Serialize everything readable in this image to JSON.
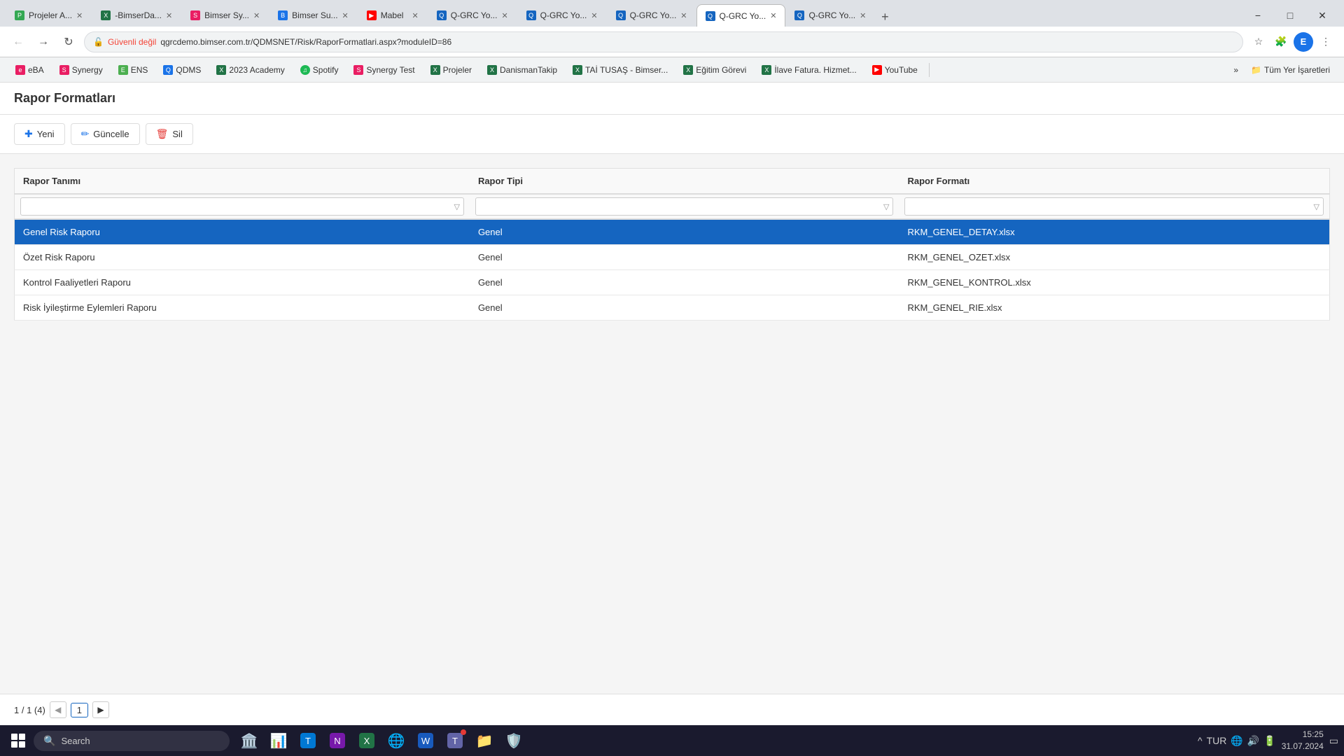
{
  "browser": {
    "tabs": [
      {
        "id": "tab1",
        "label": "Projeler A...",
        "favicon_color": "#34a853",
        "favicon_letter": "P",
        "active": false
      },
      {
        "id": "tab2",
        "label": "-BimserDa...",
        "favicon_color": "#217346",
        "favicon_letter": "X",
        "active": false
      },
      {
        "id": "tab3",
        "label": "Bimser Sy...",
        "favicon_color": "#e91e63",
        "favicon_letter": "S",
        "active": false
      },
      {
        "id": "tab4",
        "label": "Bimser Su...",
        "favicon_color": "#1a73e8",
        "favicon_letter": "B",
        "active": false
      },
      {
        "id": "tab5",
        "label": "Mabel",
        "favicon_color": "#ff0000",
        "favicon_letter": "▶",
        "active": false
      },
      {
        "id": "tab6",
        "label": "Q-GRC Yo...",
        "favicon_color": "#1565c0",
        "favicon_letter": "Q",
        "active": false
      },
      {
        "id": "tab7",
        "label": "Q-GRC Yo...",
        "favicon_color": "#1565c0",
        "favicon_letter": "Q",
        "active": false
      },
      {
        "id": "tab8",
        "label": "Q-GRC Yo...",
        "favicon_color": "#1565c0",
        "favicon_letter": "Q",
        "active": false
      },
      {
        "id": "tab9",
        "label": "Q-GRC Yo...",
        "favicon_color": "#1565c0",
        "favicon_letter": "Q",
        "active": true
      },
      {
        "id": "tab10",
        "label": "Q-GRC Yo...",
        "favicon_color": "#1565c0",
        "favicon_letter": "Q",
        "active": false
      }
    ],
    "address": "qgrcdemo.bimser.com.tr/QDMSNET/Risk/RaporFormatlari.aspx?moduleID=86",
    "security_label": "Güvenli değil",
    "profile_letter": "E"
  },
  "bookmarks": [
    {
      "label": "eBA",
      "color": "#e91e63"
    },
    {
      "label": "Synergy",
      "color": "#e91e63"
    },
    {
      "label": "ENS",
      "color": "#4caf50"
    },
    {
      "label": "QDMS",
      "color": "#1a73e8"
    },
    {
      "label": "2023 Academy",
      "color": "#217346"
    },
    {
      "label": "Spotify",
      "color": "#1db954"
    },
    {
      "label": "Synergy Test",
      "color": "#e91e63"
    },
    {
      "label": "Projeler",
      "color": "#217346"
    },
    {
      "label": "DanismanTakip",
      "color": "#217346"
    },
    {
      "label": "TAİ TUSAŞ - Bimser...",
      "color": "#217346"
    },
    {
      "label": "Eğitim Görevi",
      "color": "#217346"
    },
    {
      "label": "İlave Fatura. Hizmet...",
      "color": "#217346"
    },
    {
      "label": "YouTube",
      "color": "#ff0000"
    },
    {
      "label": "Tüm Yer İşaretleri",
      "is_folder": true
    }
  ],
  "page": {
    "title": "Rapor Formatları",
    "toolbar": {
      "new_label": "Yeni",
      "update_label": "Güncelle",
      "delete_label": "Sil"
    },
    "table": {
      "columns": [
        {
          "key": "rapor_tanimi",
          "label": "Rapor Tanımı"
        },
        {
          "key": "rapor_tipi",
          "label": "Rapor Tipi"
        },
        {
          "key": "rapor_formati",
          "label": "Rapor Formatı"
        }
      ],
      "rows": [
        {
          "rapor_tanimi": "Genel Risk Raporu",
          "rapor_tipi": "Genel",
          "rapor_formati": "RKM_GENEL_DETAY.xlsx",
          "selected": true
        },
        {
          "rapor_tanimi": "Özet Risk Raporu",
          "rapor_tipi": "Genel",
          "rapor_formati": "RKM_GENEL_OZET.xlsx",
          "selected": false
        },
        {
          "rapor_tanimi": "Kontrol Faaliyetleri Raporu",
          "rapor_tipi": "Genel",
          "rapor_formati": "RKM_GENEL_KONTROL.xlsx",
          "selected": false
        },
        {
          "rapor_tanimi": "Risk İyileştirme Eylemleri Raporu",
          "rapor_tipi": "Genel",
          "rapor_formati": "RKM_GENEL_RIE.xlsx",
          "selected": false
        }
      ]
    },
    "pagination": {
      "info": "1 / 1 (4)",
      "current_page": "1",
      "prev_disabled": true,
      "next_disabled": false
    }
  },
  "taskbar": {
    "search_placeholder": "Search",
    "time": "15:25",
    "date": "31.07.2024",
    "language": "TUR",
    "apps": [
      {
        "name": "file-explorer",
        "icon": "🗂️"
      },
      {
        "name": "settings",
        "icon": "⚙️"
      },
      {
        "name": "teams",
        "icon": "👥"
      },
      {
        "name": "onenote",
        "icon": "📓"
      },
      {
        "name": "excel",
        "icon": "📊"
      },
      {
        "name": "chrome",
        "icon": "🌐"
      },
      {
        "name": "word",
        "icon": "📝"
      },
      {
        "name": "teams2",
        "icon": "💬"
      },
      {
        "name": "folder",
        "icon": "📁"
      },
      {
        "name": "security",
        "icon": "🛡️"
      }
    ]
  }
}
